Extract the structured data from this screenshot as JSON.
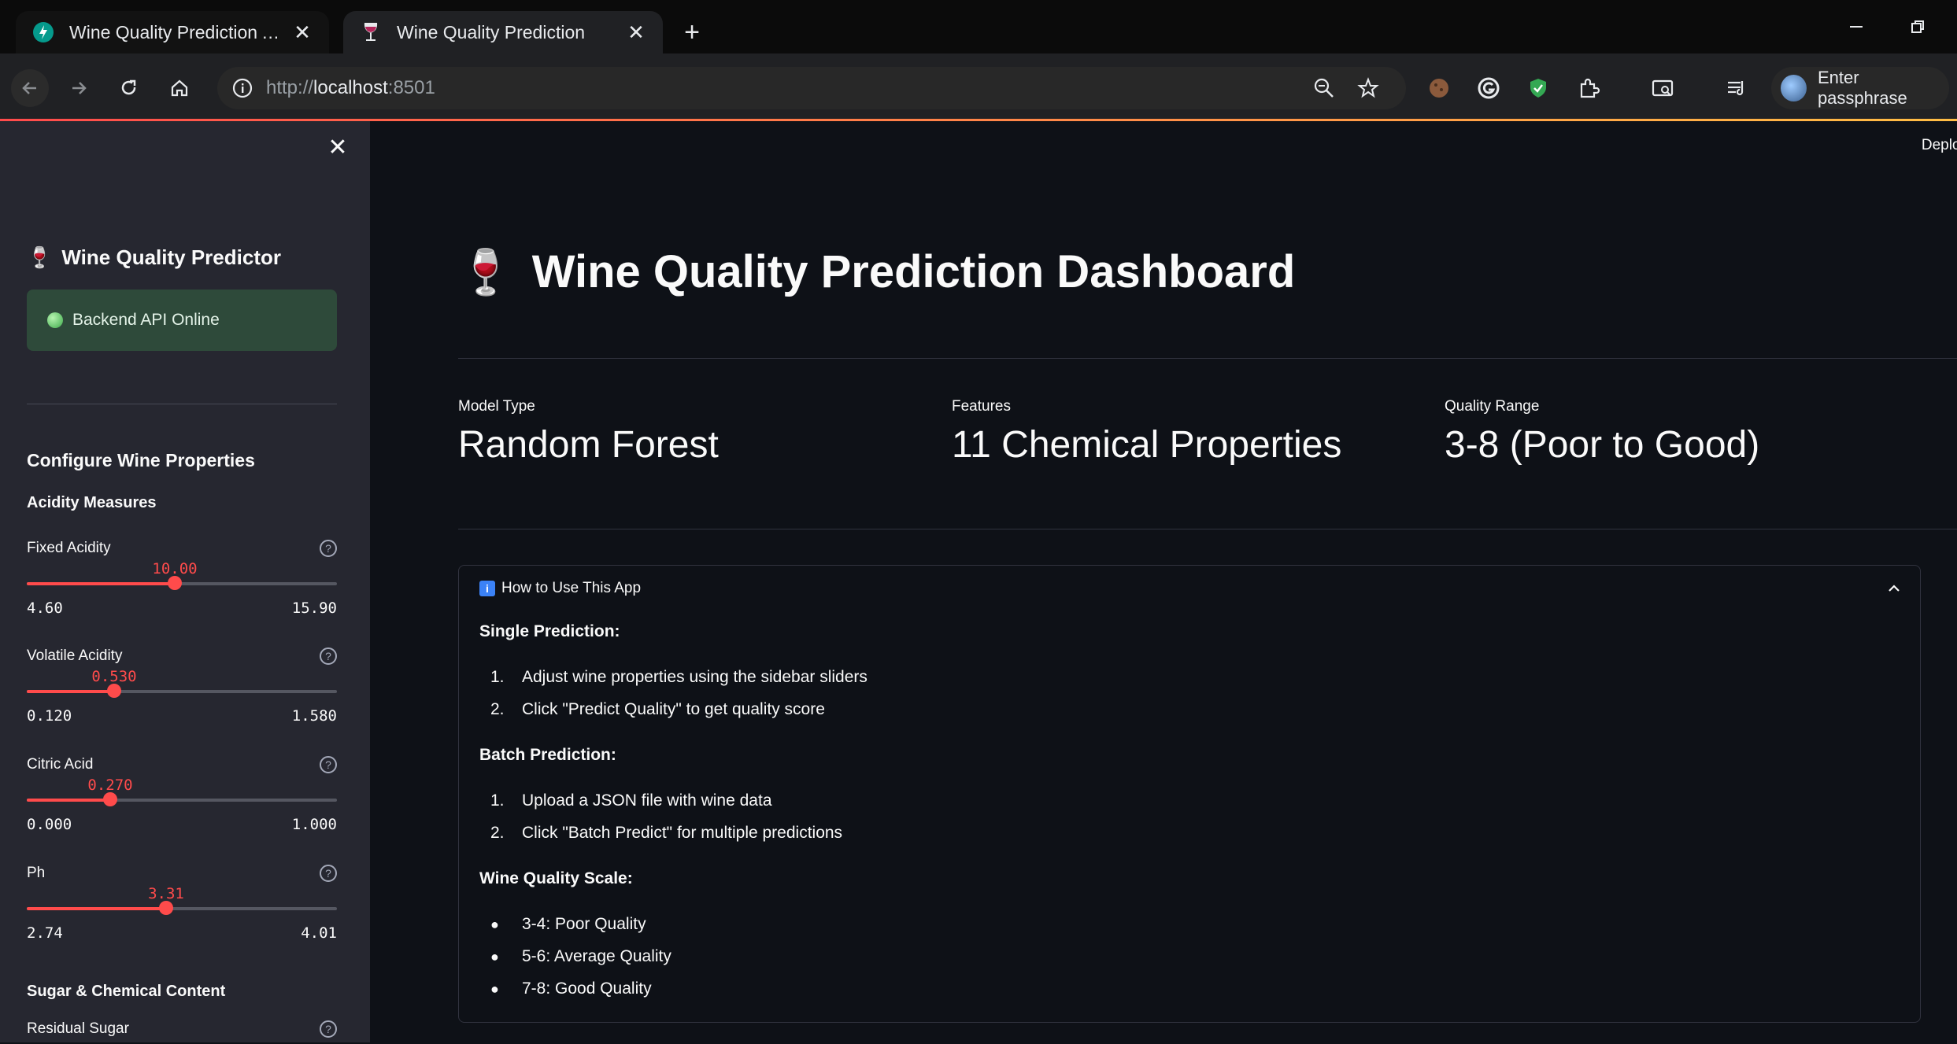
{
  "browser": {
    "tabs": [
      {
        "title": "Wine Quality Prediction API - Sw",
        "active": false,
        "icon": "fastapi-icon"
      },
      {
        "title": "Wine Quality Prediction",
        "active": true,
        "icon": "wine-glass-icon"
      }
    ],
    "url_scheme": "http://",
    "url_host": "localhost",
    "url_port": ":8501",
    "profile_label": "Enter passphrase"
  },
  "sidebar": {
    "title_emoji": "🍷",
    "title": "Wine Quality Predictor",
    "status": "Backend API Online",
    "section_title": "Configure Wine Properties",
    "group1": "Acidity Measures",
    "group2": "Sugar & Chemical Content",
    "sliders": [
      {
        "label": "Fixed Acidity",
        "value": "10.00",
        "min": "4.60",
        "max": "15.90",
        "fraction": 0.478
      },
      {
        "label": "Volatile Acidity",
        "value": "0.530",
        "min": "0.120",
        "max": "1.580",
        "fraction": 0.281
      },
      {
        "label": "Citric Acid",
        "value": "0.270",
        "min": "0.000",
        "max": "1.000",
        "fraction": 0.27
      },
      {
        "label": "Ph",
        "value": "3.31",
        "min": "2.74",
        "max": "4.01",
        "fraction": 0.449
      },
      {
        "label": "Residual Sugar"
      }
    ]
  },
  "main": {
    "deploy_label": "Deploy",
    "title_emoji": "🍷",
    "title": "Wine Quality Prediction Dashboard",
    "metrics": [
      {
        "label": "Model Type",
        "value": "Random Forest"
      },
      {
        "label": "Features",
        "value": "11 Chemical Properties"
      },
      {
        "label": "Quality Range",
        "value": "3-8 (Poor to Good)"
      }
    ],
    "expander": {
      "info_glyph": "i",
      "title": "How to Use This App",
      "single_heading": "Single Prediction:",
      "single_steps": [
        "Adjust wine properties using the sidebar sliders",
        "Click \"Predict Quality\" to get quality score"
      ],
      "batch_heading": "Batch Prediction:",
      "batch_steps": [
        "Upload a JSON file with wine data",
        "Click \"Batch Predict\" for multiple predictions"
      ],
      "scale_heading": "Wine Quality Scale:",
      "scale_items": [
        "3-4: Poor Quality",
        "5-6: Average Quality",
        "7-8: Good Quality"
      ]
    }
  }
}
